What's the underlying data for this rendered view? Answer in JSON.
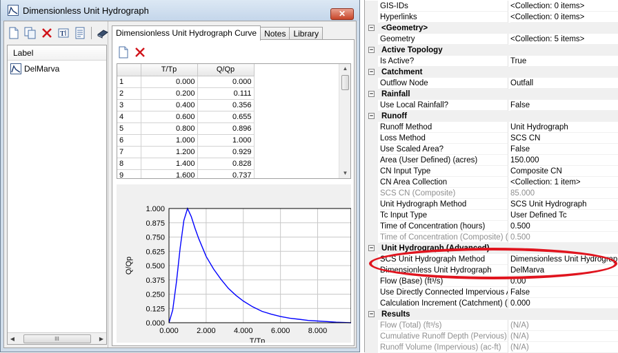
{
  "dialog": {
    "title": "Dimensionless Unit Hydrograph",
    "close_label": "✕",
    "list_header": "Label",
    "list_items": [
      "DelMarva"
    ],
    "tabs": [
      {
        "label": "Dimensionless Unit Hydrograph Curve",
        "active": true
      },
      {
        "label": "Notes",
        "active": false
      },
      {
        "label": "Library",
        "active": false
      }
    ],
    "table": {
      "columns": [
        "T/Tp",
        "Q/Qp"
      ],
      "rows": [
        [
          "1",
          "0.000",
          "0.000"
        ],
        [
          "2",
          "0.200",
          "0.111"
        ],
        [
          "3",
          "0.400",
          "0.356"
        ],
        [
          "4",
          "0.600",
          "0.655"
        ],
        [
          "5",
          "0.800",
          "0.896"
        ],
        [
          "6",
          "1.000",
          "1.000"
        ],
        [
          "7",
          "1.200",
          "0.929"
        ],
        [
          "8",
          "1.400",
          "0.828"
        ],
        [
          "9",
          "1.600",
          "0.737"
        ]
      ]
    }
  },
  "chart_data": {
    "type": "line",
    "xlabel": "T/Tp",
    "ylabel": "Q/Qp",
    "xlim": [
      0,
      9.8
    ],
    "ylim": [
      0,
      1.0
    ],
    "xticks": [
      "0.000",
      "2.000",
      "4.000",
      "6.000",
      "8.000"
    ],
    "xtick_values": [
      0,
      2,
      4,
      6,
      8
    ],
    "yticks": [
      "0.000",
      "0.125",
      "0.250",
      "0.375",
      "0.500",
      "0.625",
      "0.750",
      "0.875",
      "1.000"
    ],
    "ytick_values": [
      0,
      0.125,
      0.25,
      0.375,
      0.5,
      0.625,
      0.75,
      0.875,
      1.0
    ],
    "grid": true,
    "series": [
      {
        "x": [
          0,
          0.2,
          0.4,
          0.6,
          0.8,
          1.0,
          1.2,
          1.4,
          1.6,
          2.0,
          2.4,
          2.8,
          3.2,
          3.6,
          4.0,
          4.5,
          5.0,
          5.5,
          6.0,
          6.5,
          7.0,
          7.5,
          8.0,
          8.5,
          9.0,
          9.8
        ],
        "y": [
          0,
          0.111,
          0.356,
          0.655,
          0.896,
          1.0,
          0.929,
          0.828,
          0.737,
          0.58,
          0.47,
          0.38,
          0.3,
          0.24,
          0.19,
          0.14,
          0.1,
          0.075,
          0.055,
          0.04,
          0.03,
          0.02,
          0.015,
          0.01,
          0.005,
          0.0
        ],
        "color": "#0000ff"
      }
    ]
  },
  "properties": {
    "rows": [
      {
        "type": "prop",
        "name": "GIS-IDs",
        "value": "<Collection: 0 items>"
      },
      {
        "type": "prop",
        "name": "Hyperlinks",
        "value": "<Collection: 0 items>"
      },
      {
        "type": "cat",
        "name": "<Geometry>"
      },
      {
        "type": "prop",
        "name": "Geometry",
        "value": "<Collection: 5 items>"
      },
      {
        "type": "cat",
        "name": "Active Topology"
      },
      {
        "type": "prop",
        "name": "Is Active?",
        "value": "True"
      },
      {
        "type": "cat",
        "name": "Catchment"
      },
      {
        "type": "prop",
        "name": "Outflow Node",
        "value": "Outfall"
      },
      {
        "type": "cat",
        "name": "Rainfall"
      },
      {
        "type": "prop",
        "name": "Use Local Rainfall?",
        "value": "False"
      },
      {
        "type": "cat",
        "name": "Runoff"
      },
      {
        "type": "prop",
        "name": "Runoff Method",
        "value": "Unit Hydrograph"
      },
      {
        "type": "prop",
        "name": "Loss Method",
        "value": "SCS CN"
      },
      {
        "type": "prop",
        "name": "Use Scaled Area?",
        "value": "False"
      },
      {
        "type": "prop",
        "name": "Area (User Defined) (acres)",
        "value": "150.000"
      },
      {
        "type": "prop",
        "name": "CN Input Type",
        "value": "Composite CN"
      },
      {
        "type": "prop",
        "name": "CN Area Collection",
        "value": "<Collection: 1 item>"
      },
      {
        "type": "prop",
        "name": "SCS CN (Composite)",
        "value": "85.000",
        "disabled": true
      },
      {
        "type": "prop",
        "name": "Unit Hydrograph Method",
        "value": "SCS Unit Hydrograph"
      },
      {
        "type": "prop",
        "name": "Tc Input Type",
        "value": "User Defined Tc"
      },
      {
        "type": "prop",
        "name": "Time of Concentration (hours)",
        "value": "0.500"
      },
      {
        "type": "prop",
        "name": "Time of Concentration (Composite) (h",
        "value": "0.500",
        "disabled": true
      },
      {
        "type": "cat",
        "name": "Unit Hydrograph (Advanced)"
      },
      {
        "type": "prop",
        "name": "SCS Unit Hydrograph Method",
        "value": "Dimensionless Unit Hydrograph"
      },
      {
        "type": "prop",
        "name": "Dimensionless Unit Hydrograph",
        "value": "DelMarva"
      },
      {
        "type": "prop",
        "name": "Flow (Base) (ft³/s)",
        "value": "0.00"
      },
      {
        "type": "prop",
        "name": "Use Directly Connected Impervious A",
        "value": "False"
      },
      {
        "type": "prop",
        "name": "Calculation Increment (Catchment) (h",
        "value": "0.000"
      },
      {
        "type": "cat",
        "name": "Results"
      },
      {
        "type": "prop",
        "name": "Flow (Total) (ft³/s)",
        "value": "(N/A)",
        "disabled": true
      },
      {
        "type": "prop",
        "name": "Cumulative Runoff Depth (Pervious) (",
        "value": "(N/A)",
        "disabled": true
      },
      {
        "type": "prop",
        "name": "Runoff Volume (Impervious) (ac-ft)",
        "value": "(N/A)",
        "disabled": true
      }
    ]
  },
  "colors": {
    "curve": "#0000ff",
    "highlight": "#e0141e"
  }
}
